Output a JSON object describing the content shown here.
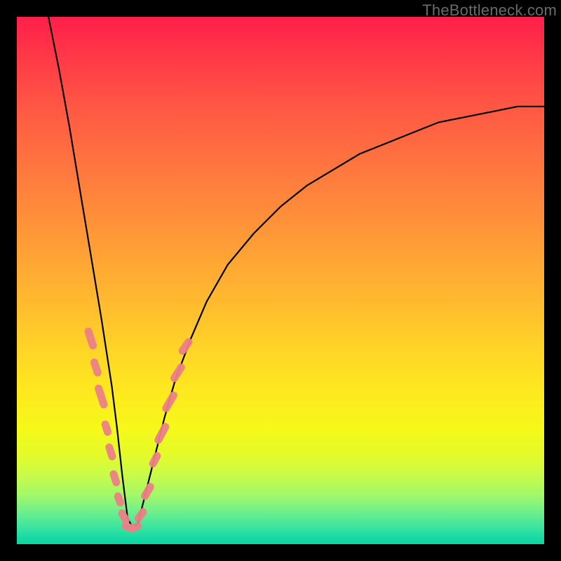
{
  "watermark": "TheBottleneck.com",
  "colors": {
    "frame": "#000000",
    "curve": "#000000",
    "marker": "#ec7f86"
  },
  "chart_data": {
    "type": "line",
    "title": "",
    "xlabel": "",
    "ylabel": "",
    "xlim": [
      0,
      100
    ],
    "ylim": [
      0,
      100
    ],
    "grid": false,
    "legend": false,
    "note": "Values are visually estimated; chart has no axis ticks or labels. x runs left→right 0–100, y runs bottom→top 0–100. Single V-shaped curve with minimum near x≈21, plus scattered pink marker pills clustered around the valley.",
    "series": [
      {
        "name": "curve",
        "x": [
          6,
          8,
          10,
          12,
          14,
          16,
          18,
          19,
          20,
          21,
          22,
          23,
          24,
          26,
          28,
          30,
          33,
          36,
          40,
          45,
          50,
          55,
          60,
          65,
          70,
          75,
          80,
          85,
          90,
          95,
          100
        ],
        "y": [
          100,
          90,
          79,
          67,
          55,
          43,
          30,
          22,
          13,
          5,
          3,
          4,
          8,
          16,
          24,
          31,
          39,
          46,
          53,
          59,
          64,
          68,
          71,
          74,
          76,
          78,
          80,
          81,
          82,
          83,
          83
        ]
      }
    ],
    "markers": [
      {
        "x": 14.0,
        "y": 39.0,
        "len": 5.5,
        "angle": -72
      },
      {
        "x": 15.0,
        "y": 33.5,
        "len": 4.5,
        "angle": -72
      },
      {
        "x": 16.0,
        "y": 28.0,
        "len": 6.0,
        "angle": -72
      },
      {
        "x": 17.0,
        "y": 22.0,
        "len": 3.8,
        "angle": -72
      },
      {
        "x": 17.8,
        "y": 17.5,
        "len": 4.2,
        "angle": -72
      },
      {
        "x": 18.6,
        "y": 12.5,
        "len": 4.0,
        "angle": -72
      },
      {
        "x": 19.4,
        "y": 8.5,
        "len": 3.5,
        "angle": -70
      },
      {
        "x": 20.3,
        "y": 5.2,
        "len": 3.8,
        "angle": -60
      },
      {
        "x": 21.2,
        "y": 3.2,
        "len": 3.5,
        "angle": -20
      },
      {
        "x": 22.4,
        "y": 3.2,
        "len": 3.5,
        "angle": 20
      },
      {
        "x": 23.5,
        "y": 5.5,
        "len": 3.8,
        "angle": 55
      },
      {
        "x": 24.8,
        "y": 10.0,
        "len": 4.5,
        "angle": 60
      },
      {
        "x": 26.2,
        "y": 16.0,
        "len": 4.0,
        "angle": 62
      },
      {
        "x": 27.5,
        "y": 21.0,
        "len": 5.5,
        "angle": 62
      },
      {
        "x": 29.0,
        "y": 27.0,
        "len": 5.5,
        "angle": 60
      },
      {
        "x": 30.5,
        "y": 32.5,
        "len": 5.0,
        "angle": 58
      },
      {
        "x": 32.0,
        "y": 37.5,
        "len": 4.5,
        "angle": 55
      }
    ]
  }
}
